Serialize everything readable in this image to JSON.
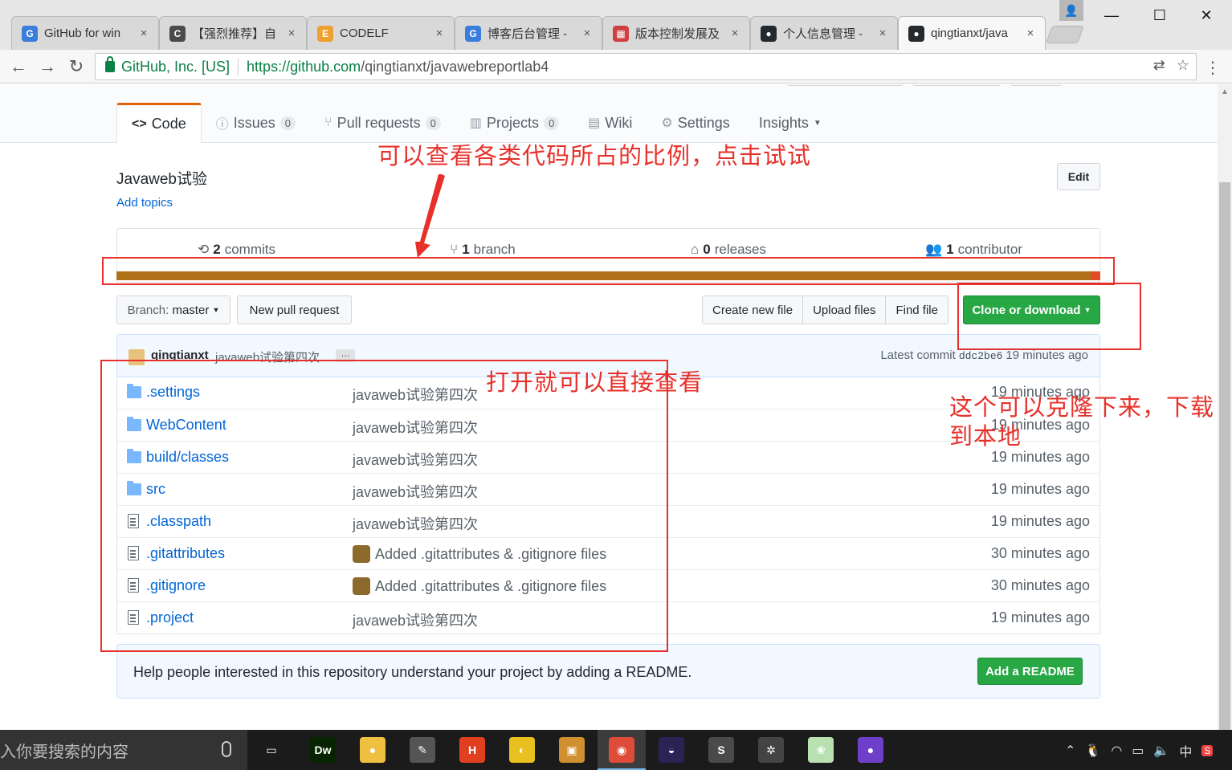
{
  "browser": {
    "tabs": [
      {
        "title": "GitHub for win",
        "color": "#3b7ddd",
        "glyph": "G"
      },
      {
        "title": "【强烈推荐】自",
        "color": "#4a4a4a",
        "glyph": "C"
      },
      {
        "title": "CODELF",
        "color": "#f0a030",
        "glyph": "E"
      },
      {
        "title": "博客后台管理 -",
        "color": "#3b7ddd",
        "glyph": "G"
      },
      {
        "title": "版本控制发展及",
        "color": "#d04040",
        "glyph": "▦"
      },
      {
        "title": "个人信息管理 -",
        "color": "#24292e",
        "glyph": "●"
      },
      {
        "title": "qingtianxt/java",
        "color": "#24292e",
        "glyph": "●"
      }
    ],
    "tab_close": "×",
    "secure_label": "GitHub, Inc. [US]",
    "url_host": "https://github.com",
    "url_path": "/qingtianxt/javawebreportlab4",
    "window_controls": {
      "minimize": "—",
      "maximize": "☐",
      "close": "✕"
    }
  },
  "repo_nav": {
    "code": "Code",
    "issues": "Issues",
    "issues_count": "0",
    "pull_requests": "Pull requests",
    "pull_requests_count": "0",
    "projects": "Projects",
    "projects_count": "0",
    "wiki": "Wiki",
    "settings": "Settings",
    "insights": "Insights"
  },
  "repo": {
    "description": "Javaweb试验",
    "add_topics": "Add topics",
    "edit": "Edit"
  },
  "numbers": {
    "commits_count": "2",
    "commits_label": "commits",
    "branch_count": "1",
    "branch_label": "branch",
    "releases_count": "0",
    "releases_label": "releases",
    "contributor_count": "1",
    "contributor_label": "contributor"
  },
  "language_bar": {
    "primary_color": "#b07219",
    "secondary_color": "#e34c26"
  },
  "file_nav": {
    "branch_prefix": "Branch:",
    "branch_name": "master",
    "new_pull_request": "New pull request",
    "create_new_file": "Create new file",
    "upload_files": "Upload files",
    "find_file": "Find file",
    "clone_or_download": "Clone or download"
  },
  "latest_commit": {
    "author": "qingtianxt",
    "message": "javaweb试验第四次",
    "ellipsis": "…",
    "prefix": "Latest commit",
    "sha": "ddc2be6",
    "age": "19 minutes ago"
  },
  "files": [
    {
      "type": "folder",
      "name": ".settings",
      "message": "javaweb试验第四次",
      "age": "19 minutes ago",
      "avatar": false
    },
    {
      "type": "folder",
      "name": "WebContent",
      "message": "javaweb试验第四次",
      "age": "19 minutes ago",
      "avatar": false
    },
    {
      "type": "folder",
      "name": "build/classes",
      "message": "javaweb试验第四次",
      "age": "19 minutes ago",
      "avatar": false
    },
    {
      "type": "folder",
      "name": "src",
      "message": "javaweb试验第四次",
      "age": "19 minutes ago",
      "avatar": false
    },
    {
      "type": "file",
      "name": ".classpath",
      "message": "javaweb试验第四次",
      "age": "19 minutes ago",
      "avatar": false
    },
    {
      "type": "file",
      "name": ".gitattributes",
      "message": "Added .gitattributes & .gitignore files",
      "age": "30 minutes ago",
      "avatar": true
    },
    {
      "type": "file",
      "name": ".gitignore",
      "message": "Added .gitattributes & .gitignore files",
      "age": "30 minutes ago",
      "avatar": true
    },
    {
      "type": "file",
      "name": ".project",
      "message": "javaweb试验第四次",
      "age": "19 minutes ago",
      "avatar": false
    }
  ],
  "readme": {
    "text": "Help people interested in this repository understand your project by adding a README.",
    "button": "Add a README"
  },
  "annotations": {
    "language_hint": "可以查看各类代码所占的比例，点击试试",
    "open_hint": "打开就可以直接查看",
    "clone_hint_line1": "这个可以克隆下来，下载",
    "clone_hint_line2": "到本地"
  },
  "taskbar": {
    "search_placeholder": "入你要搜索的内容",
    "apps": [
      {
        "name": "task-view",
        "color": "#1b1b1b",
        "glyph": "▭"
      },
      {
        "name": "dreamweaver",
        "color": "#072401",
        "glyph": "Dw"
      },
      {
        "name": "app-bird",
        "color": "#f0c040",
        "glyph": "●"
      },
      {
        "name": "app-tools",
        "color": "#555",
        "glyph": "✎"
      },
      {
        "name": "hbuilder",
        "color": "#e04020",
        "glyph": "H"
      },
      {
        "name": "app-circle",
        "color": "#e8c020",
        "glyph": "◐"
      },
      {
        "name": "app-box",
        "color": "#d09030",
        "glyph": "▣"
      },
      {
        "name": "chrome",
        "color": "#dd4b39",
        "glyph": "◉"
      },
      {
        "name": "eclipse",
        "color": "#2c2255",
        "glyph": "◒"
      },
      {
        "name": "sublime",
        "color": "#4a4a4a",
        "glyph": "S"
      },
      {
        "name": "app-gear",
        "color": "#444",
        "glyph": "✲"
      },
      {
        "name": "app-leaf",
        "color": "#b8e0b0",
        "glyph": "❀"
      },
      {
        "name": "github-desktop",
        "color": "#6e40c9",
        "glyph": "●"
      }
    ],
    "ime": "中"
  }
}
